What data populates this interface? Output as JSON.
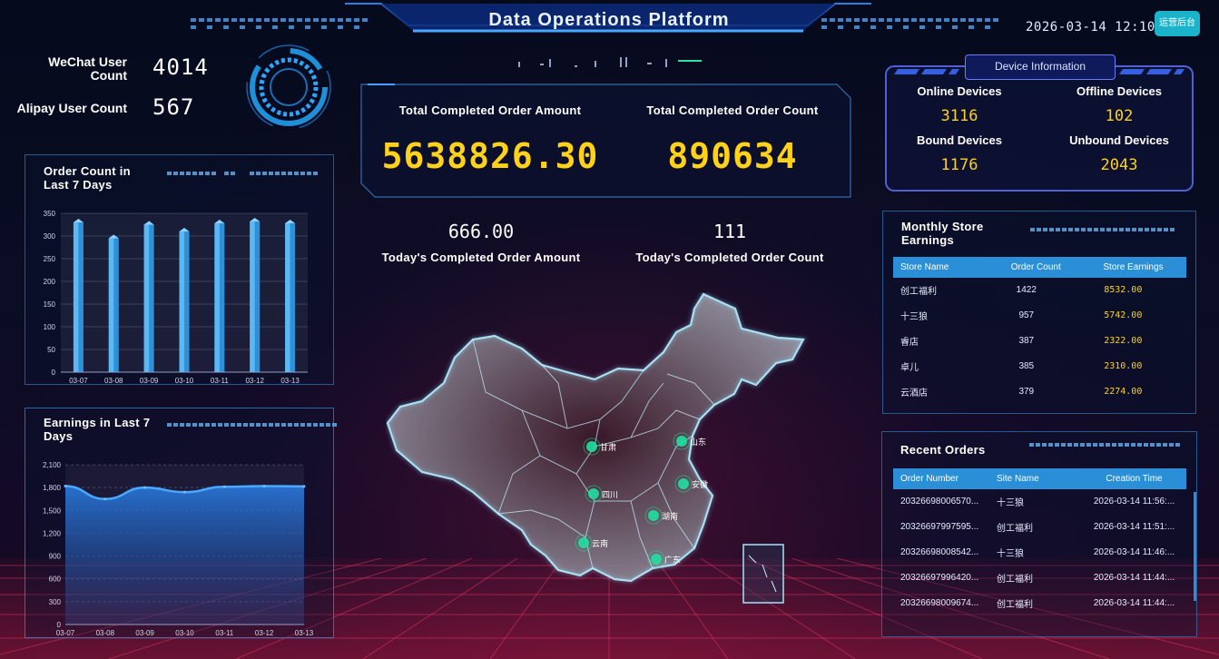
{
  "header": {
    "title": "Data Operations Platform",
    "datetime": "2026-03-14 12:10:07",
    "admin_button": "运营后台"
  },
  "users": {
    "wechat_label": "WeChat User Count",
    "wechat_value": "4014",
    "alipay_label": "Alipay User Count",
    "alipay_value": "567"
  },
  "totals": {
    "amount_label": "Total Completed Order Amount",
    "amount_value": "5638826.30",
    "count_label": "Total Completed Order Count",
    "count_value": "890634"
  },
  "today": {
    "amount_value": "666.00",
    "amount_label": "Today's Completed Order Amount",
    "count_value": "111",
    "count_label": "Today's Completed Order Count"
  },
  "devices": {
    "title": "Device Information",
    "online_label": "Online Devices",
    "online_value": "3116",
    "offline_label": "Offline Devices",
    "offline_value": "102",
    "bound_label": "Bound Devices",
    "bound_value": "1176",
    "unbound_label": "Unbound Devices",
    "unbound_value": "2043"
  },
  "order_chart": {
    "title": "Order Count in Last 7 Days"
  },
  "earnings_chart": {
    "title": "Earnings in Last 7 Days"
  },
  "chart_data": [
    {
      "type": "bar",
      "title": "Order Count in Last 7 Days",
      "categories": [
        "03-07",
        "03-08",
        "03-09",
        "03-10",
        "03-11",
        "03-12",
        "03-13"
      ],
      "values": [
        330,
        295,
        325,
        310,
        328,
        332,
        328
      ],
      "ylim": [
        0,
        350
      ],
      "yticks": [
        "0",
        "50",
        "100",
        "150",
        "200",
        "250",
        "300",
        "350"
      ],
      "grid": true
    },
    {
      "type": "area",
      "title": "Earnings in Last 7 Days",
      "categories": [
        "03-07",
        "03-08",
        "03-09",
        "03-10",
        "03-11",
        "03-12",
        "03-13"
      ],
      "values": [
        1820,
        1650,
        1800,
        1740,
        1810,
        1820,
        1815
      ],
      "ylim": [
        0,
        2100
      ],
      "yticks": [
        "0",
        "300",
        "600",
        "900",
        "1,200",
        "1,500",
        "1,800",
        "2,100"
      ],
      "grid": true
    }
  ],
  "store_earnings": {
    "title": "Monthly Store Earnings",
    "columns": [
      "Store Name",
      "Order Count",
      "Store Earnings"
    ],
    "rows": [
      [
        "创工福利",
        "1422",
        "8532.00"
      ],
      [
        "十三狼",
        "957",
        "5742.00"
      ],
      [
        "睿店",
        "387",
        "2322.00"
      ],
      [
        "卓儿",
        "385",
        "2310.00"
      ],
      [
        "云酒店",
        "379",
        "2274.00"
      ]
    ]
  },
  "recent_orders": {
    "title": "Recent Orders",
    "columns": [
      "Order Number",
      "Site Name",
      "Creation Time"
    ],
    "rows": [
      [
        "20326698006570...",
        "十三狼",
        "2026-03-14 11:56:..."
      ],
      [
        "20326697997595...",
        "创工福利",
        "2026-03-14 11:51:..."
      ],
      [
        "20326698008542...",
        "十三狼",
        "2026-03-14 11:46:..."
      ],
      [
        "20326697996420...",
        "创工福利",
        "2026-03-14 11:44:..."
      ],
      [
        "20326698009674...",
        "创工福利",
        "2026-03-14 11:44:..."
      ]
    ]
  },
  "map": {
    "cities": [
      "甘肃",
      "山东",
      "四川",
      "安徽",
      "湖南",
      "云南",
      "广东"
    ]
  },
  "colors": {
    "accent_gold": "#ffd21a",
    "table_header": "#2a8fd6",
    "bar_blue": "#3a9de0",
    "map_dot": "#1fe0a0"
  }
}
